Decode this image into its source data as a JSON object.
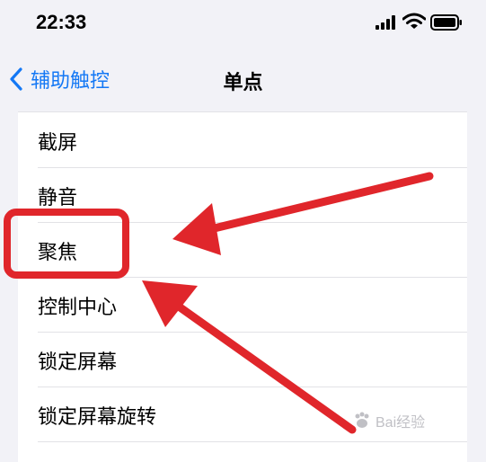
{
  "status_bar": {
    "time": "22:33"
  },
  "nav": {
    "back_label": "辅助触控",
    "title": "单点"
  },
  "list": {
    "items": [
      {
        "label": "截屏"
      },
      {
        "label": "静音"
      },
      {
        "label": "聚焦"
      },
      {
        "label": "控制中心"
      },
      {
        "label": "锁定屏幕"
      },
      {
        "label": "锁定屏幕旋转"
      }
    ]
  },
  "annotation": {
    "highlighted_item": "聚焦",
    "highlight_color": "#e0262b"
  },
  "watermark": {
    "text": "Bai经验"
  },
  "colors": {
    "accent": "#1478f5",
    "background": "#f2f2f7",
    "annotation_red": "#e0262b"
  }
}
